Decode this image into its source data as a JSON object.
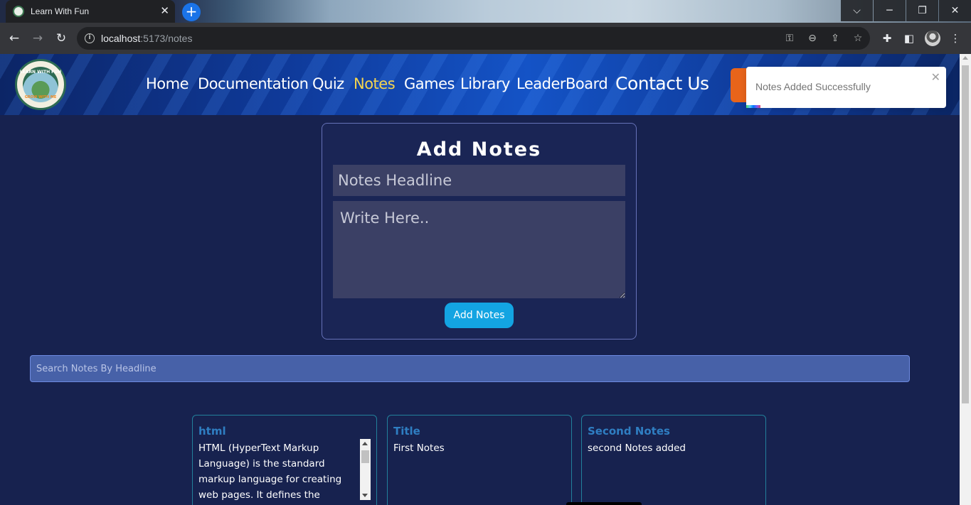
{
  "browser": {
    "tab_title": "Learn With Fun",
    "url_host": "localhost",
    "url_path": ":5173/notes"
  },
  "nav": {
    "links": [
      {
        "label": "Home"
      },
      {
        "label": "Documentation"
      },
      {
        "label": "Quiz"
      },
      {
        "label": "Notes",
        "active": true
      },
      {
        "label": "Games"
      },
      {
        "label": "Library"
      },
      {
        "label": "LeaderBoard"
      },
      {
        "label": "Contact Us"
      }
    ]
  },
  "logo": {
    "top_text": "LEARN WITH FUN",
    "bottom_text": "GROW WITH ME",
    "year_left": "20",
    "year_right": "23"
  },
  "toast": {
    "message": "Notes Added Successfully"
  },
  "add_notes": {
    "title": "Add Notes",
    "headline_placeholder": "Notes Headline",
    "body_placeholder": "Write Here..",
    "button_label": "Add Notes"
  },
  "search": {
    "placeholder": "Search Notes By Headline"
  },
  "notes": [
    {
      "title": "html",
      "body": "HTML (HyperText Markup Language) is the standard markup language for creating web pages. It defines the structure of a web page"
    },
    {
      "title": "Title",
      "body": "First Notes"
    },
    {
      "title": "Second Notes",
      "body": "second Notes added"
    }
  ],
  "colors": {
    "page_bg": "#17224f",
    "active_nav": "#f5d54f",
    "accent_button": "#13a4e2",
    "note_title": "#2f7ec2"
  }
}
